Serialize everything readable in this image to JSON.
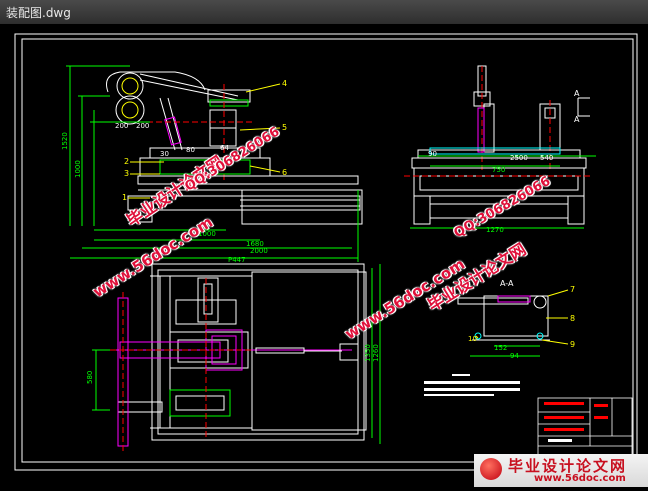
{
  "window": {
    "title": "装配图.dwg"
  },
  "drawing": {
    "dims_left": [
      "1520",
      "1000",
      "200",
      "200",
      "80",
      "30",
      "64",
      "1000",
      "1680",
      "2000",
      "P447"
    ],
    "dims_right": [
      "90",
      "2500",
      "540",
      "750",
      "1270",
      "A",
      "A",
      "A-A",
      "152",
      "94"
    ],
    "dims_bottom": [
      "580",
      "1350",
      "1260"
    ],
    "part_labels": [
      "4",
      "5",
      "2",
      "3",
      "6",
      "1",
      "7",
      "8",
      "9",
      "10"
    ]
  },
  "watermarks": {
    "site": "www.56doc.com",
    "brand": "毕业设计论文网",
    "qq": "QQ:306826066"
  },
  "footer": {
    "brand": "毕业设计论文网",
    "site": "www.56doc.com"
  },
  "colors": {
    "frame": "#ffffff",
    "outline": "#ffffff",
    "dimension": "#00ff00",
    "part": "#ff00ff",
    "center": "#ff0000",
    "yellow": "#ffff00",
    "cyan": "#00ffff",
    "watermark": "#e0103a"
  }
}
